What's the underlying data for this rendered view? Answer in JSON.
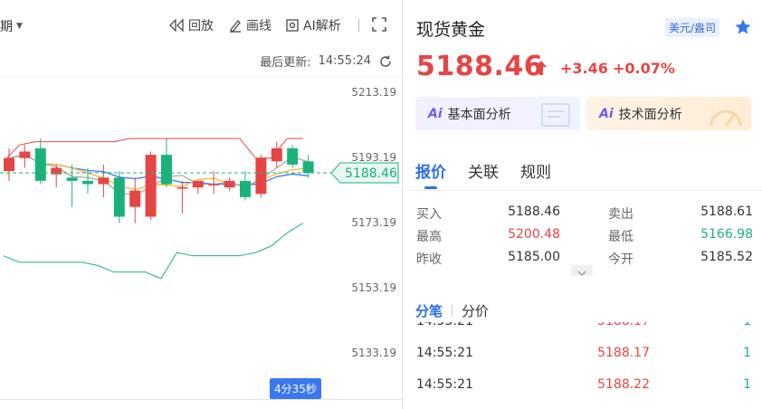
{
  "toolbar": {
    "period_label": "期",
    "replay_label": "回放",
    "draw_label": "画线",
    "ai_label": "AI解析",
    "last_update_label": "最后更新:",
    "last_update_time": "14:55:24"
  },
  "chart": {
    "y_ticks": [
      "5213.19",
      "5193.19",
      "5173.19",
      "5153.19",
      "5133.19"
    ],
    "current_price_tag": "5188.46",
    "timer": "4分35秒",
    "colors": {
      "up": "#e54545",
      "down": "#1bb27a",
      "ma_blue": "#3a78f2",
      "ma_yellow": "#f5b731",
      "ma_gray": "#aaaaaa"
    }
  },
  "info": {
    "title": "现货黄金",
    "unit": "美元/盎司",
    "price": "5188.46",
    "change": "+3.46",
    "change_pct": "+0.07%",
    "fundamental_label": "基本面分析",
    "technical_label": "技术面分析",
    "ai_badge": "Ai",
    "tabs": [
      "报价",
      "关联",
      "规则"
    ],
    "quote": [
      {
        "l1": "买入",
        "v1": "5188.46",
        "l2": "卖出",
        "v2": "5188.61"
      },
      {
        "l1": "最高",
        "v1": "5200.48",
        "l2": "最低",
        "v2": "5166.98"
      },
      {
        "l1": "昨收",
        "v1": "5185.00",
        "l2": "今开",
        "v2": "5185.52"
      }
    ],
    "subtabs": [
      "分笔",
      "分价"
    ],
    "trades": [
      {
        "time": "14:55:21",
        "price": "5188.17",
        "vol": "1"
      },
      {
        "time": "14:55:21",
        "price": "5188.22",
        "vol": "1"
      }
    ]
  },
  "chart_data": {
    "type": "candlestick",
    "y_axis": {
      "ticks": [
        5213.19,
        5193.19,
        5173.19,
        5153.19,
        5133.19
      ]
    },
    "candles": [
      {
        "o": 5189,
        "h": 5196,
        "l": 5186,
        "c": 5193
      },
      {
        "o": 5193,
        "h": 5197,
        "l": 5190,
        "c": 5195
      },
      {
        "o": 5196,
        "h": 5199,
        "l": 5185,
        "c": 5186
      },
      {
        "o": 5188,
        "h": 5191,
        "l": 5184,
        "c": 5190
      },
      {
        "o": 5187,
        "h": 5191,
        "l": 5178,
        "c": 5186
      },
      {
        "o": 5186,
        "h": 5190,
        "l": 5182,
        "c": 5185
      },
      {
        "o": 5185,
        "h": 5191,
        "l": 5181,
        "c": 5187
      },
      {
        "o": 5187,
        "h": 5189,
        "l": 5173,
        "c": 5175
      },
      {
        "o": 5178,
        "h": 5187,
        "l": 5173,
        "c": 5183
      },
      {
        "o": 5175,
        "h": 5195,
        "l": 5174,
        "c": 5194
      },
      {
        "o": 5194,
        "h": 5199,
        "l": 5184,
        "c": 5185
      },
      {
        "o": 5184,
        "h": 5186,
        "l": 5176,
        "c": 5184
      },
      {
        "o": 5184,
        "h": 5186,
        "l": 5182,
        "c": 5186
      },
      {
        "o": 5185,
        "h": 5189,
        "l": 5182,
        "c": 5185
      },
      {
        "o": 5184,
        "h": 5187,
        "l": 5183,
        "c": 5186
      },
      {
        "o": 5186,
        "h": 5189,
        "l": 5180,
        "c": 5181
      },
      {
        "o": 5182,
        "h": 5194,
        "l": 5181,
        "c": 5193
      },
      {
        "o": 5192,
        "h": 5198,
        "l": 5190,
        "c": 5196
      },
      {
        "o": 5196,
        "h": 5197,
        "l": 5190,
        "c": 5191
      },
      {
        "o": 5192,
        "h": 5194,
        "l": 5187,
        "c": 5188.46
      }
    ],
    "bands": {
      "upper": [
        5192,
        5197,
        5198,
        5198,
        5198,
        5198,
        5198,
        5198,
        5199,
        5199,
        5199,
        5199,
        5199,
        5199,
        5199,
        5199,
        5193,
        5193,
        5199,
        5199
      ],
      "lower": [
        5163,
        5161,
        5161,
        5161,
        5161,
        5161,
        5160,
        5158,
        5158,
        5158,
        5156,
        5164,
        5163,
        5163,
        5163,
        5163,
        5164,
        5166,
        5170,
        5173
      ]
    }
  }
}
